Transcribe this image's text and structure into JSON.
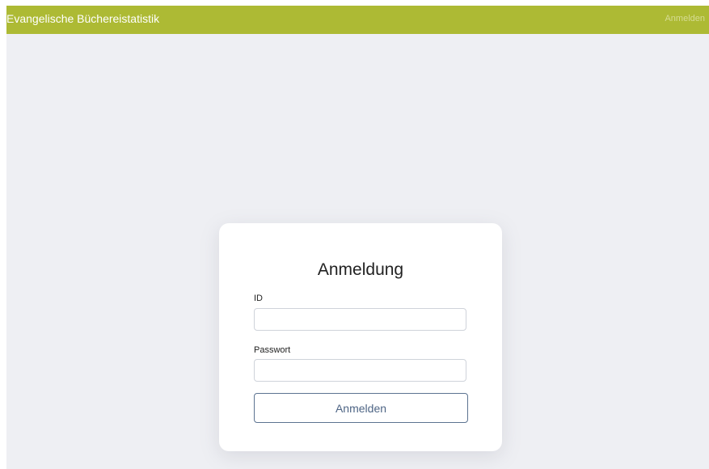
{
  "navbar": {
    "brand": "Evangelische Büchereistatistik",
    "login_link": "Anmelden"
  },
  "login": {
    "title": "Anmeldung",
    "id_label": "ID",
    "id_value": "",
    "password_label": "Passwort",
    "password_value": "",
    "submit_label": "Anmelden"
  },
  "colors": {
    "navbar": "#adba34",
    "background": "#eeeff3",
    "button_border": "#5c7391"
  }
}
